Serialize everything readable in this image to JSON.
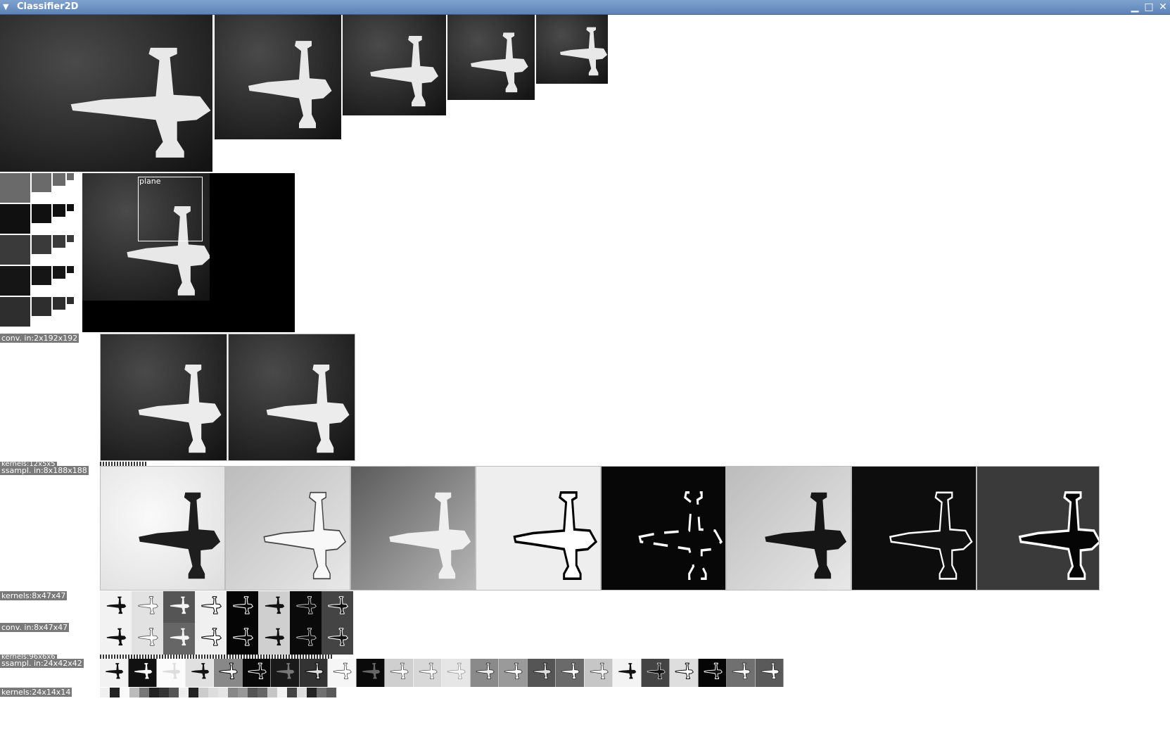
{
  "window": {
    "title": "Classifier2D",
    "menu_icon": "triangle-down-icon",
    "minimize_icon": "minimize-icon",
    "maximize_icon": "maximize-icon",
    "close_icon": "close-icon"
  },
  "detection": {
    "label": "plane"
  },
  "labels": {
    "conv_in_1": "conv. in:2x192x192",
    "kernels_1": "kernels:12x5x5",
    "subsample_1": "ssampl. in:8x188x188",
    "kernels_2": "kernels:8x47x47",
    "conv_in_2": "conv. in:8x47x47",
    "kernels_3": "kernels:96x6x6",
    "subsample_2": "ssampl. in:24x42x42",
    "kernels_4": "kernels:24x14x14"
  },
  "colors": {
    "titlebar": "#6b90c3",
    "label_bg": "#7a7a7a"
  }
}
